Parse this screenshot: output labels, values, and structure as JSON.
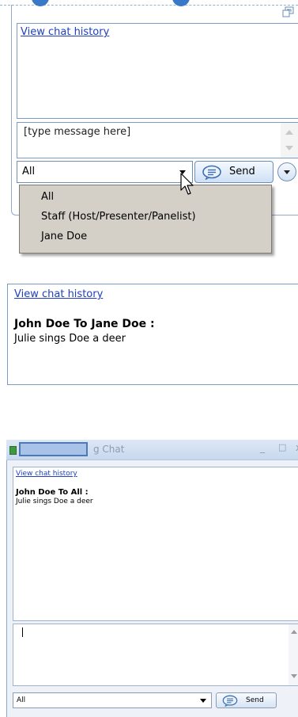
{
  "panel_dropdown_open": {
    "history_link": "View chat history",
    "message_placeholder": "[type message here]",
    "recipient_select": {
      "value": "All",
      "options": [
        "All",
        "Staff (Host/Presenter/Panelist)",
        "Jane Doe"
      ]
    },
    "send_label": "Send"
  },
  "panel_message": {
    "history_link": "View chat history",
    "message_header": "John Doe To Jane Doe :",
    "message_body": "Julie sings Doe a deer"
  },
  "panel_chat_window": {
    "title_suffix": "g Chat",
    "minimize_glyph": "_",
    "maximize_glyph": "□",
    "close_glyph": "x",
    "history_link": "View chat history",
    "message_header": "John Doe To All :",
    "message_body": "Julie sings Doe a deer",
    "recipient_value": "All",
    "send_label": "Send"
  },
  "colors": {
    "link": "#1f3fbf",
    "frame": "#7a9cc5",
    "menu_bg": "#d4d0c8",
    "titlebar": "#c7d8ee"
  }
}
